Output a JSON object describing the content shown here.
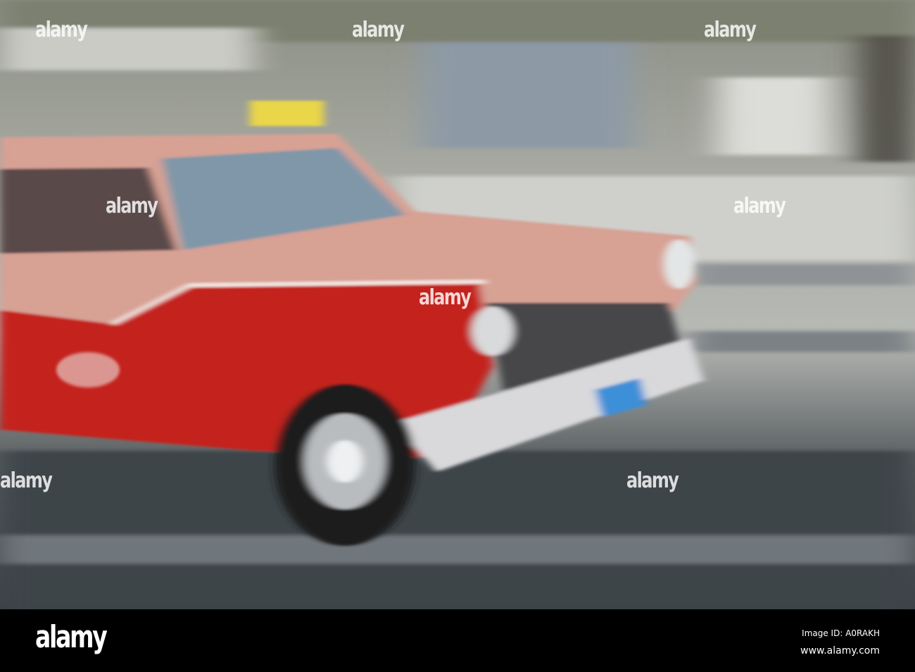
{
  "watermark": {
    "text": "alamy"
  },
  "footer": {
    "logo": "alamy",
    "image_id": "Image ID: A0RAKH",
    "url": "www.alamy.com"
  }
}
